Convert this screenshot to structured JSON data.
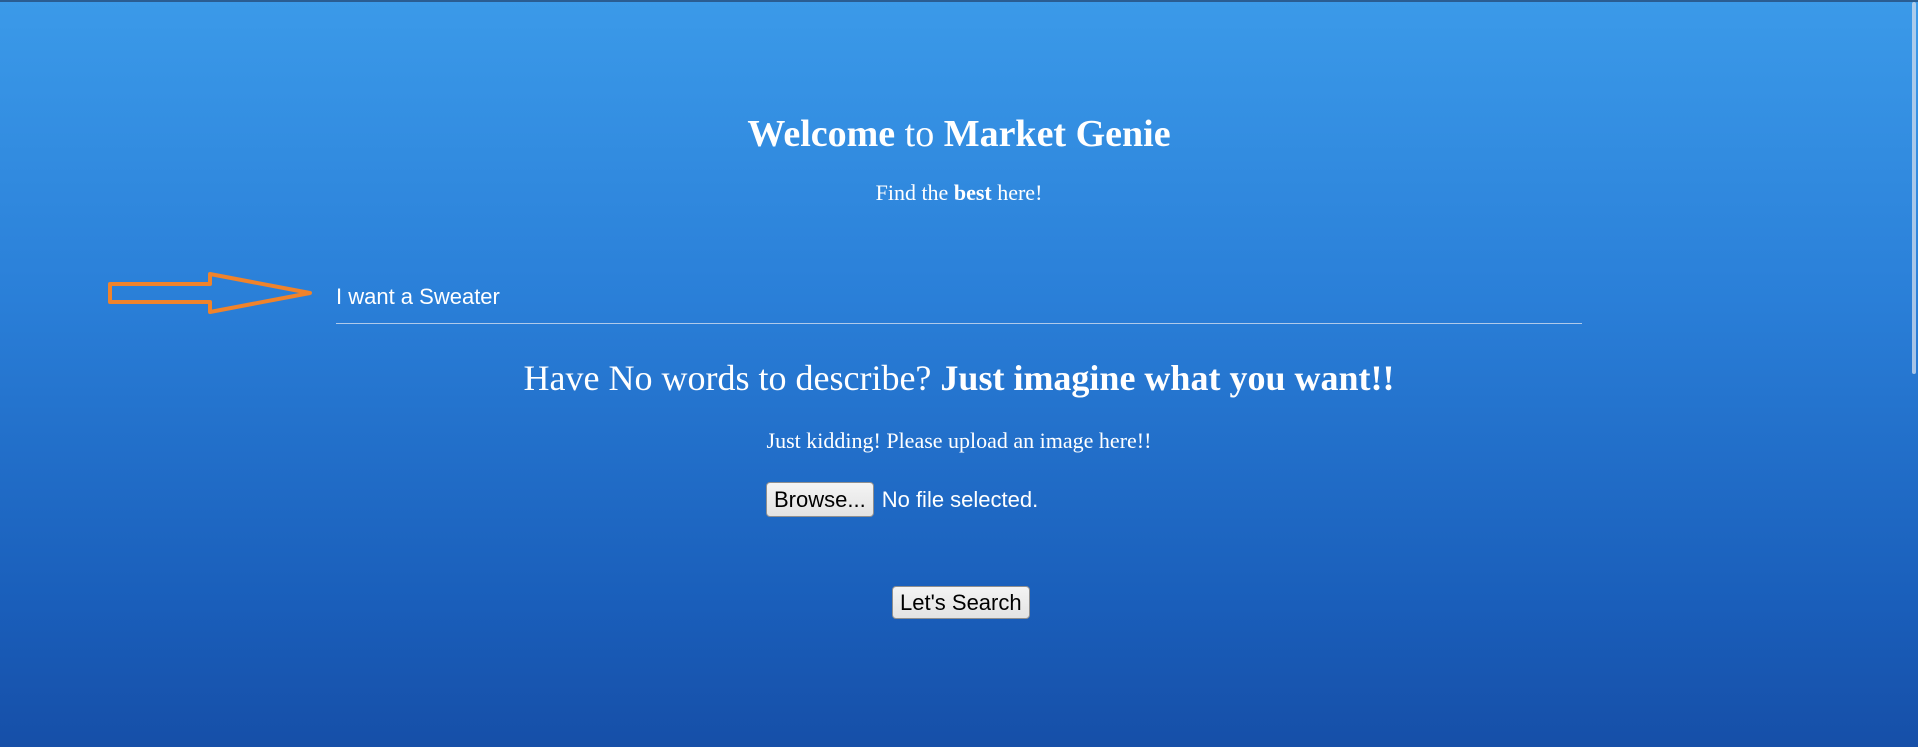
{
  "header": {
    "title_prefix_bold": "Welcome",
    "title_middle": " to ",
    "title_suffix_bold": "Market Genie",
    "subtitle_prefix": "Find the ",
    "subtitle_bold": "best",
    "subtitle_suffix": " here!"
  },
  "search": {
    "value": "I want a Sweater"
  },
  "image_section": {
    "heading_plain": "Have No words to describe? ",
    "heading_bold": "Just imagine what you want!!",
    "upload_text": "Just kidding! Please upload an image here!!",
    "browse_label": "Browse...",
    "file_status": "No file selected."
  },
  "actions": {
    "search_label": "Let's Search"
  },
  "colors": {
    "background_top": "#3b9ae9",
    "background_bottom": "#164fa8",
    "arrow": "#f0832b",
    "text": "#ffffff"
  }
}
